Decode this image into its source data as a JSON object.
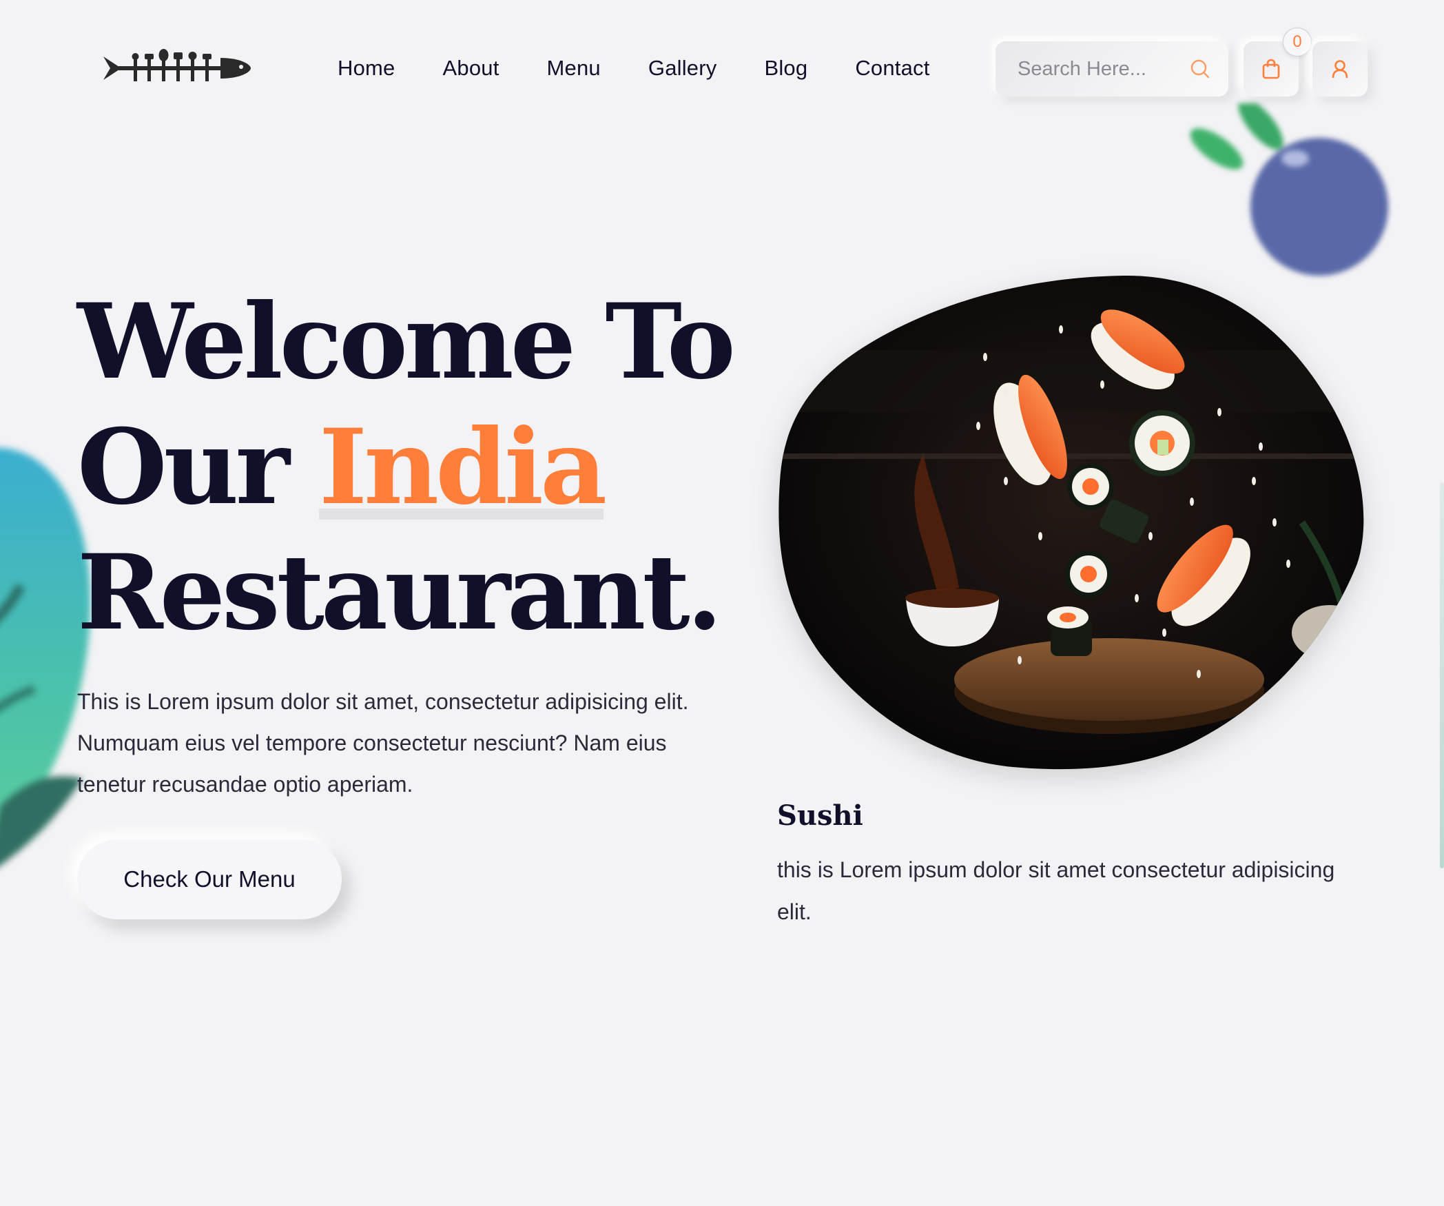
{
  "brand": {
    "logo_icon": "fish-cutlery-logo"
  },
  "nav": [
    {
      "label": "Home"
    },
    {
      "label": "About"
    },
    {
      "label": "Menu"
    },
    {
      "label": "Gallery"
    },
    {
      "label": "Blog"
    },
    {
      "label": "Contact"
    }
  ],
  "search": {
    "placeholder": "Search Here...",
    "value": "",
    "icon": "search-icon"
  },
  "cart": {
    "count": "0",
    "icon": "shopping-bag-icon"
  },
  "user": {
    "icon": "user-icon"
  },
  "hero": {
    "title_line1": "Welcome To",
    "title_line2_prefix": "Our ",
    "title_highlight": "India",
    "title_line3": "Restaurant.",
    "description": "This is Lorem ipsum dolor sit amet, consectetur adipisicing elit. Numquam eius vel tempore consectetur nesciunt? Nam eius tenetur recusandae optio aperiam.",
    "cta_label": "Check Our Menu"
  },
  "featured": {
    "title": "Sushi",
    "description": "this is Lorem ipsum dolor sit amet consectetur adipisicing elit."
  },
  "colors": {
    "background": "#f3f3f5",
    "text": "#11102a",
    "accent": "#ff7e39"
  }
}
